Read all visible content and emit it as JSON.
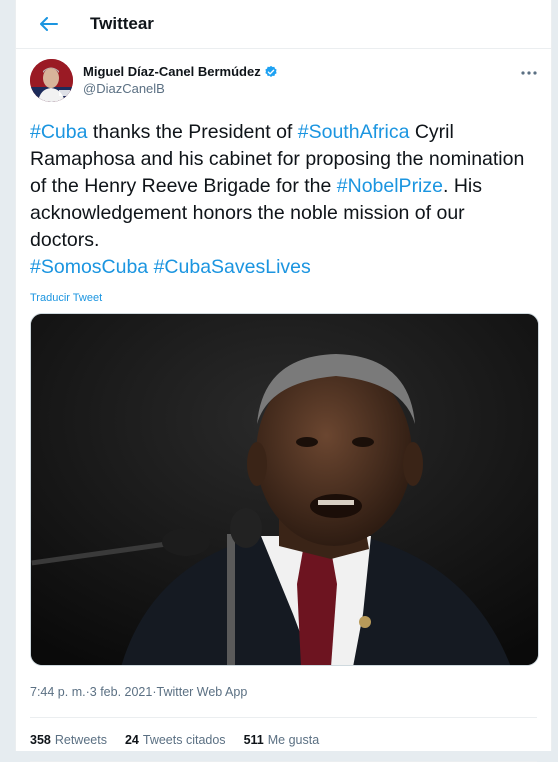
{
  "header": {
    "title": "Twittear",
    "back_icon": "arrow-left-icon"
  },
  "author": {
    "name": "Miguel Díaz-Canel Bermúdez",
    "handle": "@DiazCanelB",
    "verified": true
  },
  "tweet": {
    "segments": [
      {
        "text": "#Cuba",
        "hashtag": true
      },
      {
        "text": " thanks the President of ",
        "hashtag": false
      },
      {
        "text": "#SouthAfrica",
        "hashtag": true
      },
      {
        "text": " Cyril Ramaphosa and his cabinet for proposing the nomination of the Henry Reeve Brigade for the ",
        "hashtag": false
      },
      {
        "text": "#NobelPrize",
        "hashtag": true
      },
      {
        "text": ". His acknowledgement honors the noble mission of our doctors.",
        "hashtag": false
      }
    ],
    "tags_line": [
      {
        "text": "#SomosCuba",
        "hashtag": true
      },
      {
        "text": " ",
        "hashtag": false
      },
      {
        "text": "#CubaSavesLives",
        "hashtag": true
      }
    ],
    "translate_label": "Traducir Tweet"
  },
  "meta": {
    "time": "7:44 p. m.",
    "separator": " · ",
    "date": "3 feb. 2021",
    "source": "Twitter Web App"
  },
  "stats": {
    "retweets_count": "358",
    "retweets_label": "Retweets",
    "quotes_count": "24",
    "quotes_label": "Tweets citados",
    "likes_count": "511",
    "likes_label": "Me gusta"
  },
  "colors": {
    "accent": "#1b95e0",
    "verified": "#1da1f2",
    "secondary_text": "#5b7083"
  }
}
